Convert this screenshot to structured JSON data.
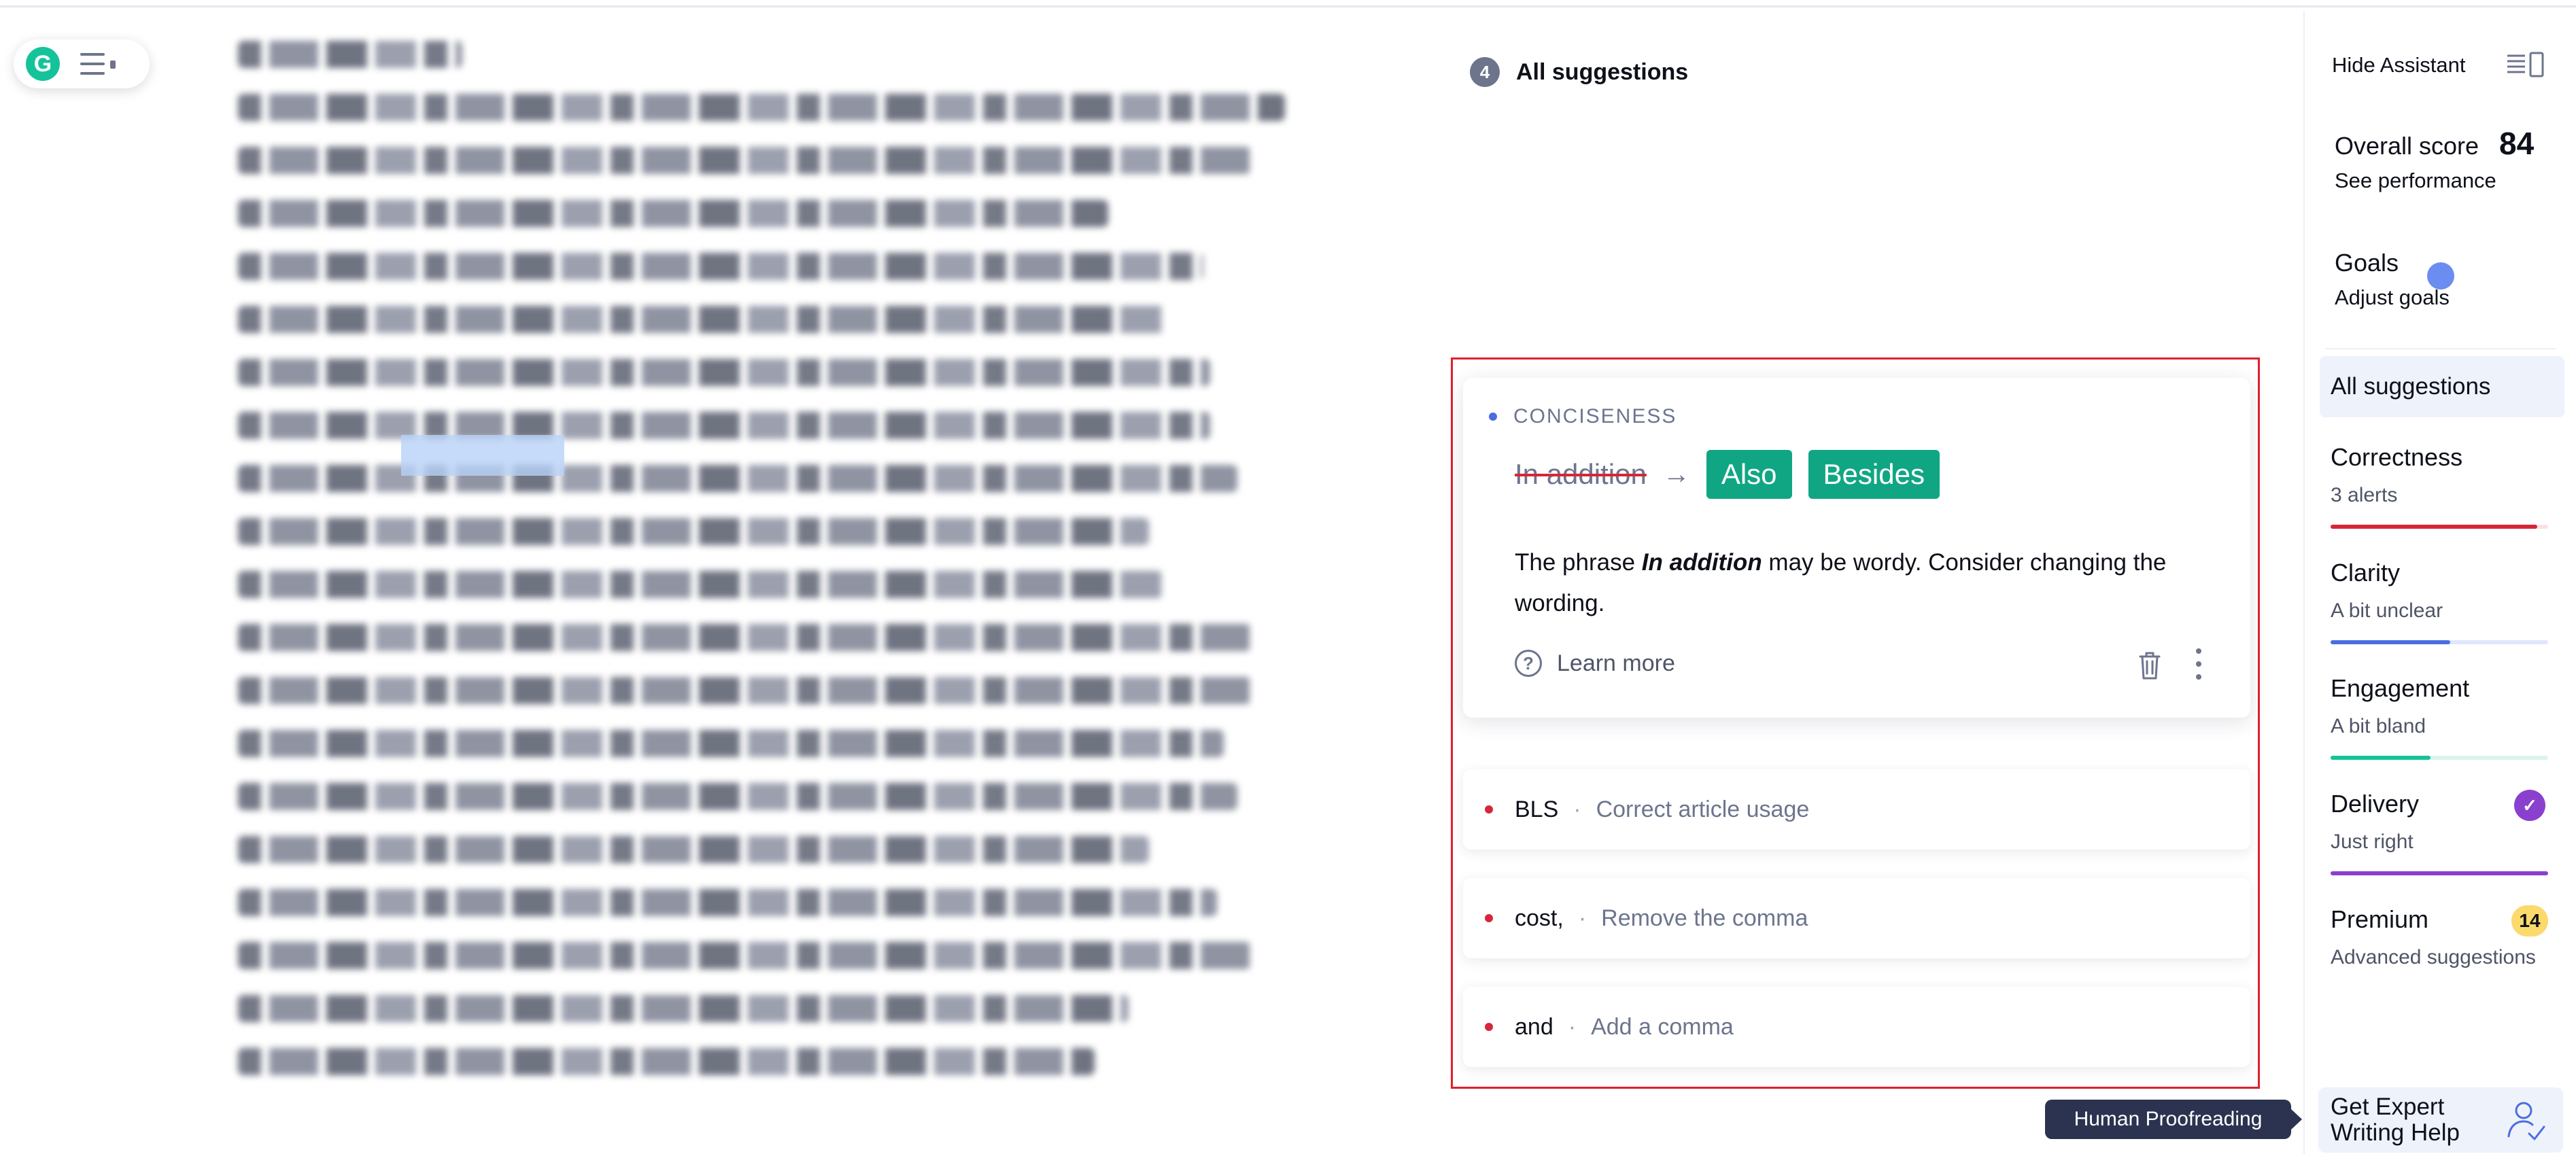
{
  "colors": {
    "accent_green": "#11a683",
    "correctness_red": "#d6263a",
    "clarity_blue": "#4a6ee0",
    "engagement_green": "#15c39a",
    "delivery_purple": "#8a40cf",
    "premium_yellow": "#fbd96b",
    "highlight_box": "#e0202f"
  },
  "icons": {
    "logo": "grammarly-g-logo",
    "menu": "hamburger-menu-icon",
    "help": "question-circle-icon",
    "trash": "trash-icon",
    "more": "vertical-ellipsis-icon",
    "panel": "panel-toggle-icon",
    "check": "checkmark-icon",
    "expert": "person-check-icon"
  },
  "logo": {
    "letter": "G"
  },
  "header": {
    "count": "4",
    "title": "All suggestions"
  },
  "active_card": {
    "category": "CONCISENESS",
    "original": "In addition",
    "arrow": "→",
    "replacements": [
      "Also",
      "Besides"
    ],
    "explanation_before": "The phrase ",
    "explanation_phrase": "In addition",
    "explanation_after": " may be wordy. Consider changing the wording.",
    "learn_more": "Learn more",
    "help_glyph": "?"
  },
  "suggestions": [
    {
      "word": "BLS",
      "separator": "·",
      "description": "Correct article usage"
    },
    {
      "word": "cost,",
      "separator": "·",
      "description": "Remove the comma"
    },
    {
      "word": "and",
      "separator": "·",
      "description": "Add a comma"
    }
  ],
  "sidebar": {
    "hide_assistant": "Hide Assistant",
    "overall_score_label": "Overall score",
    "overall_score_value": "84",
    "see_performance": "See performance",
    "goals_label": "Goals",
    "adjust_goals": "Adjust goals",
    "all_suggestions": "All suggestions",
    "categories": [
      {
        "name": "Correctness",
        "status": "3 alerts",
        "progress": 0.95
      },
      {
        "name": "Clarity",
        "status": "A bit unclear",
        "progress": 0.55
      },
      {
        "name": "Engagement",
        "status": "A bit bland",
        "progress": 0.46
      },
      {
        "name": "Delivery",
        "status": "Just right",
        "progress": 1.0,
        "check": "✓"
      }
    ],
    "premium": {
      "name": "Premium",
      "count": "14",
      "status": "Advanced suggestions"
    },
    "tooltip": "Human Proofreading",
    "expert_help": "Get Expert Writing Help"
  }
}
